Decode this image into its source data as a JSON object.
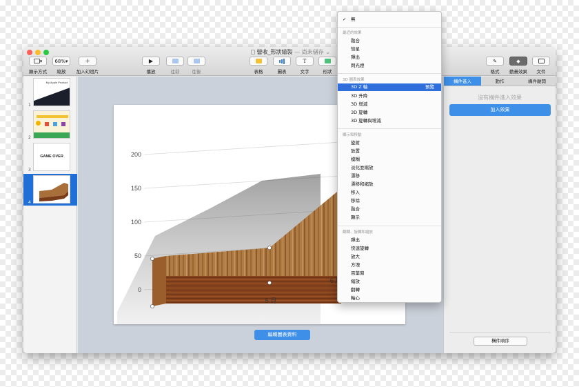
{
  "window": {
    "doc_title": "營收_形狀繪製",
    "doc_status": "— 尚未儲存",
    "status_chevron": "⌄"
  },
  "toolbar": {
    "view": {
      "label": "顯示方式"
    },
    "zoom": {
      "value": "68%",
      "label": "縮放"
    },
    "add_slide": {
      "label": "加入幻燈片"
    },
    "play": {
      "label": "播放"
    },
    "forward": {
      "label": "往前"
    },
    "back": {
      "label": "往後"
    },
    "table": {
      "label": "表格"
    },
    "chart": {
      "label": "圖表"
    },
    "text": {
      "label": "文字"
    },
    "shape": {
      "label": "形狀"
    },
    "format": {
      "label": "格式"
    },
    "animate": {
      "label": "動畫效果"
    },
    "document": {
      "label": "文件"
    }
  },
  "slides": [
    {
      "num": "1",
      "caption": "My Apple Product"
    },
    {
      "num": "2",
      "caption": ""
    },
    {
      "num": "3",
      "caption": "GAME OVER"
    },
    {
      "num": "4",
      "caption": ""
    }
  ],
  "chart_data": {
    "type": "area",
    "categories": [
      "4 月",
      "5 月",
      "6 月"
    ],
    "series": [
      {
        "values": [
          50,
          62,
          150
        ]
      }
    ],
    "yticks": [
      "0",
      "50",
      "100",
      "150",
      "200"
    ],
    "ylim": [
      0,
      200
    ]
  },
  "canvas": {
    "edit_chart_data": "編輯圖表資料"
  },
  "inspector": {
    "tabs": [
      "構件進入",
      "動作",
      "構件離開"
    ],
    "empty_text": "沒有構件進入效果",
    "add_effect": "加入效果",
    "build_order": "構件順序"
  },
  "menu": {
    "none": "無",
    "checkmark": "✓",
    "section_recent": "最近的效果",
    "recent": [
      "融合",
      "彗星",
      "彈出",
      "閃光燈"
    ],
    "section_3d": "3D 圖表效果",
    "effects_3d": [
      "3D Z 軸",
      "3D 升降",
      "3D 增減",
      "3D 旋轉",
      "3D 旋轉與增減"
    ],
    "default_tag": "預覽",
    "section_appear": "顯示和移動",
    "appear": [
      "旋射",
      "放置",
      "模糊",
      "淡化並縮放",
      "漂移",
      "漂移和縮放",
      "移入",
      "移除",
      "融合",
      "顯示"
    ],
    "section_flip": "翻轉、旋轉和縮放",
    "flip": [
      "彈出",
      "快速旋轉",
      "放大",
      "方塊",
      "百葉窗",
      "縮放",
      "翻轉",
      "軸心"
    ]
  },
  "colors": {
    "accent": "#3d8fe8",
    "highlight": "#2f6fdc",
    "wood_light": "#b5824a",
    "wood_dark": "#7a3b18"
  }
}
